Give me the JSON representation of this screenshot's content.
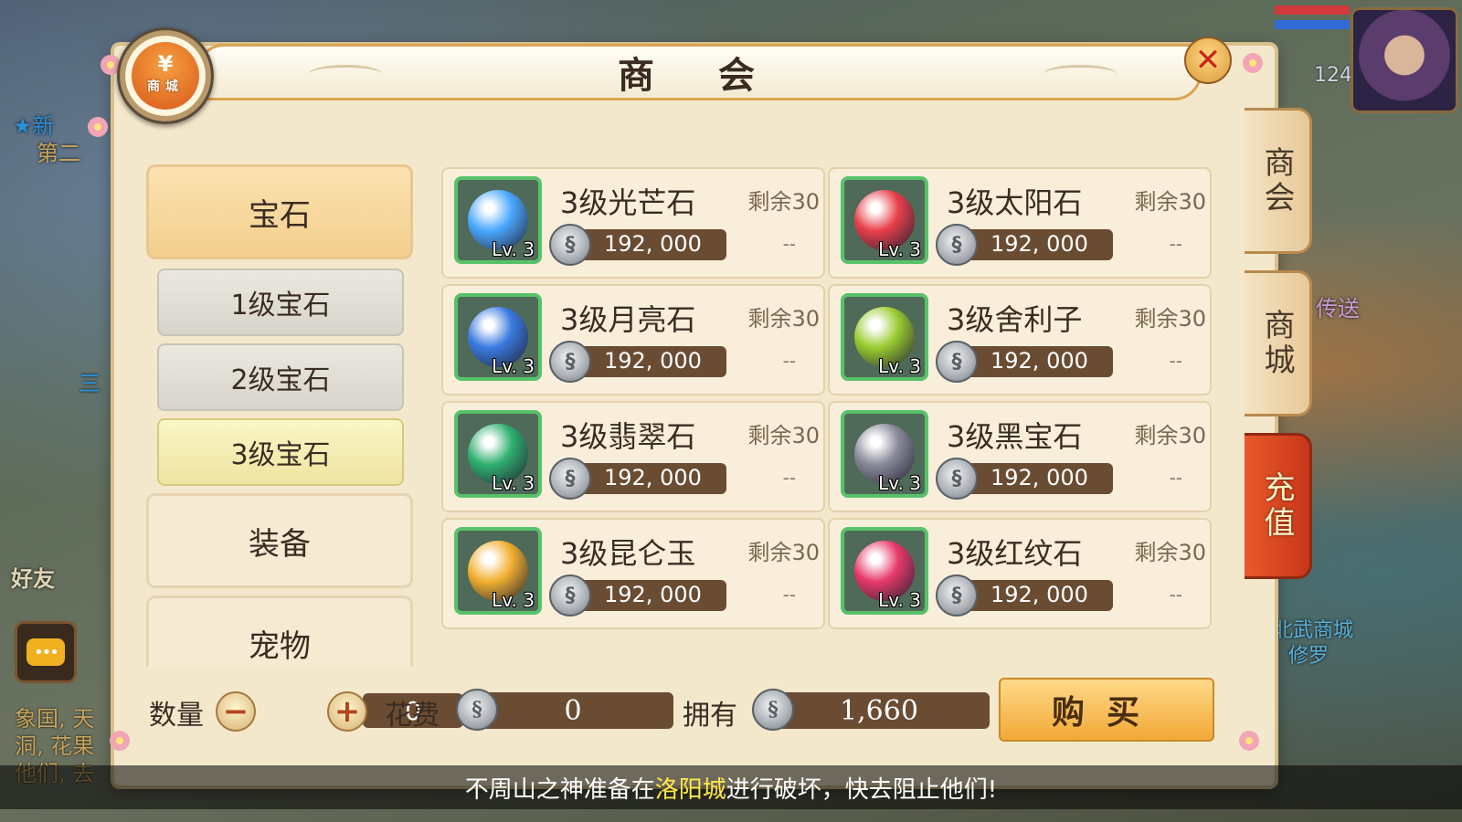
{
  "background": {
    "left_texts": [
      "★新",
      "第二",
      "三"
    ],
    "right_text_1": "传送",
    "right_text_2": "北武商城",
    "right_text_3": "修罗",
    "friends_label": "好友",
    "chat_log": [
      "象国, 天",
      "洞, 花果",
      "他们, 去"
    ],
    "hud_level": "124",
    "chat_icon": "chat-bubble-icon"
  },
  "dialog": {
    "title": "商 会",
    "badge_symbol": "¥",
    "badge_label": "商城",
    "close_symbol": "✕"
  },
  "side_tabs": [
    {
      "label": "商会",
      "active": true
    },
    {
      "label": "商城",
      "active": false
    },
    {
      "label": "充值",
      "active": false
    }
  ],
  "categories": {
    "gems": "宝石",
    "sub": [
      "1级宝石",
      "2级宝石",
      "3级宝石"
    ],
    "equipment": "装备",
    "pets": "宠物"
  },
  "items": [
    {
      "name": "3级光芒石",
      "stock": "剩余30",
      "price": "192, 000",
      "limit": "--",
      "level": "Lv. 3",
      "gem_color": "#4aa8ff"
    },
    {
      "name": "3级太阳石",
      "stock": "剩余30",
      "price": "192, 000",
      "limit": "--",
      "level": "Lv. 3",
      "gem_color": "#e8404a"
    },
    {
      "name": "3级月亮石",
      "stock": "剩余30",
      "price": "192, 000",
      "limit": "--",
      "level": "Lv. 3",
      "gem_color": "#3a7ae0"
    },
    {
      "name": "3级舍利子",
      "stock": "剩余30",
      "price": "192, 000",
      "limit": "--",
      "level": "Lv. 3",
      "gem_color": "#9acb30"
    },
    {
      "name": "3级翡翠石",
      "stock": "剩余30",
      "price": "192, 000",
      "limit": "--",
      "level": "Lv. 3",
      "gem_color": "#2fb070"
    },
    {
      "name": "3级黑宝石",
      "stock": "剩余30",
      "price": "192, 000",
      "limit": "--",
      "level": "Lv. 3",
      "gem_color": "#8a8a9a"
    },
    {
      "name": "3级昆仑玉",
      "stock": "剩余30",
      "price": "192, 000",
      "limit": "--",
      "level": "Lv. 3",
      "gem_color": "#f2b030"
    },
    {
      "name": "3级红纹石",
      "stock": "剩余30",
      "price": "192, 000",
      "limit": "--",
      "level": "Lv. 3",
      "gem_color": "#e83a6a"
    }
  ],
  "bottom": {
    "quantity_label": "数量",
    "quantity_value": "0",
    "minus": "−",
    "plus": "+",
    "cost_label": "花费",
    "cost_value": "0",
    "owned_label": "拥有",
    "owned_value": "1,660",
    "buy_label": "购买",
    "coin_glyph": "§"
  },
  "announcement": {
    "prefix": "不周山之神准备在",
    "highlight": "洛阳城",
    "suffix": "进行破坏，快去阻止他们!"
  }
}
